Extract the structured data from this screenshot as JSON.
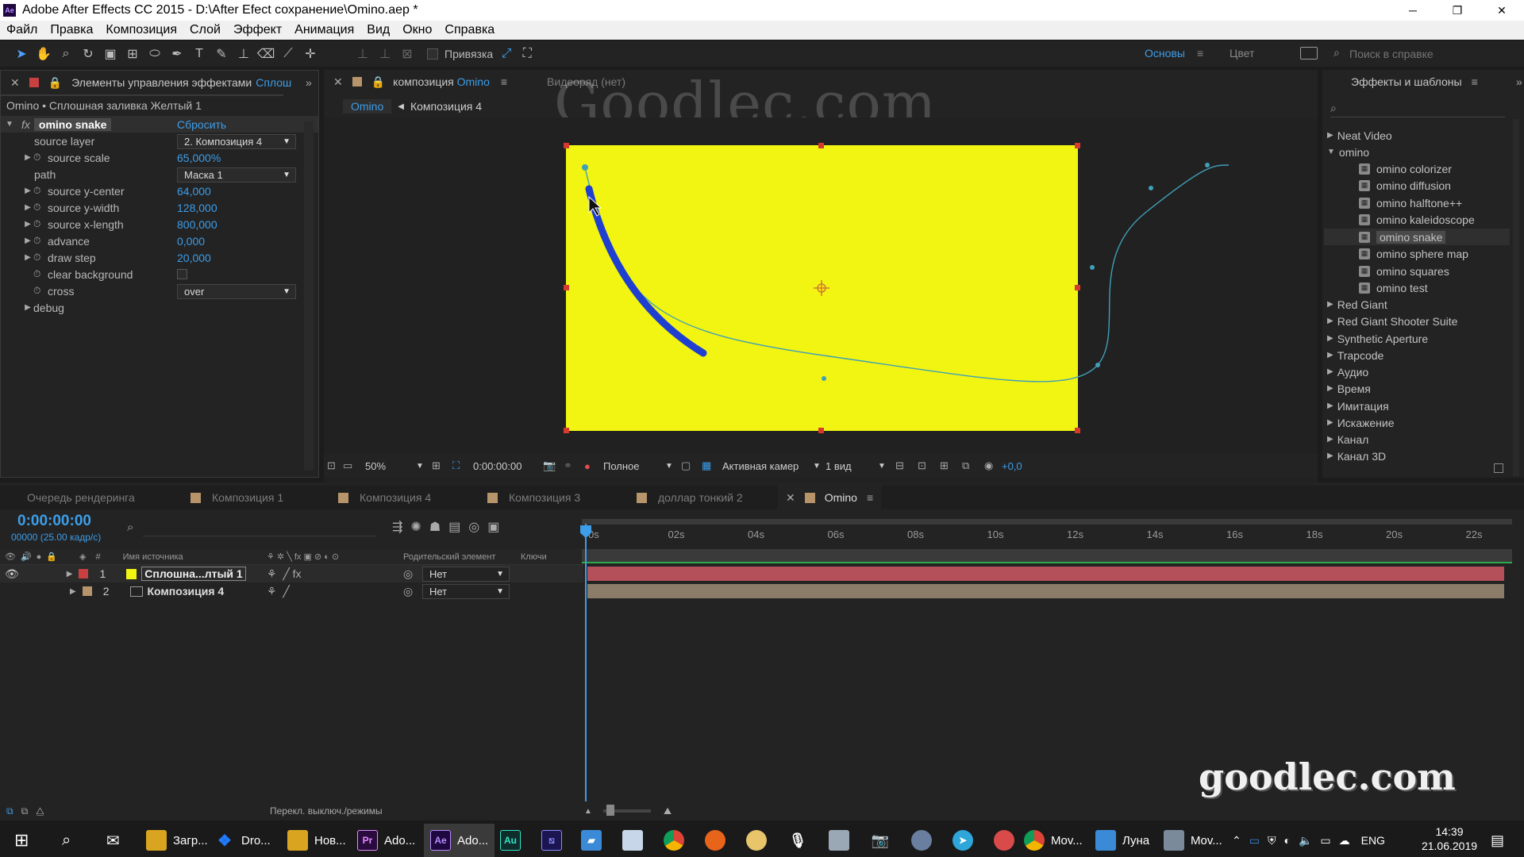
{
  "app": {
    "title": "Adobe After Effects CC 2015 - D:\\After Efect сохранение\\Omino.aep *",
    "logo": "Ae"
  },
  "menu": [
    "Файл",
    "Правка",
    "Композиция",
    "Слой",
    "Эффект",
    "Анимация",
    "Вид",
    "Окно",
    "Справка"
  ],
  "toolbar": {
    "snap_label": "Привязка",
    "workspace_basic": "Основы",
    "workspace_color": "Цвет",
    "help_search_placeholder": "Поиск в справке"
  },
  "effects_panel": {
    "tab_title": "Элементы управления эффектами",
    "tab_layer": "Сплош",
    "layer_path": "Omino • Сплошная заливка Желтый 1",
    "effect_name": "omino snake",
    "reset_label": "Сбросить",
    "params": [
      {
        "name": "source layer",
        "value": "2. Композиция 4",
        "kind": "dropdown"
      },
      {
        "name": "source scale",
        "value": "65,000%",
        "kind": "number"
      },
      {
        "name": "path",
        "value": "Маска 1",
        "kind": "dropdown"
      },
      {
        "name": "source y-center",
        "value": "64,000",
        "kind": "number"
      },
      {
        "name": "source y-width",
        "value": "128,000",
        "kind": "number"
      },
      {
        "name": "source x-length",
        "value": "800,000",
        "kind": "number"
      },
      {
        "name": "advance",
        "value": "0,000",
        "kind": "number"
      },
      {
        "name": "draw step",
        "value": "20,000",
        "kind": "number"
      },
      {
        "name": "clear background",
        "value": "",
        "kind": "checkbox"
      },
      {
        "name": "cross",
        "value": "over",
        "kind": "dropdown"
      },
      {
        "name": "debug",
        "value": "",
        "kind": "group"
      }
    ]
  },
  "comp_panel": {
    "tab_prefix": "композиция",
    "tab_name": "Omino",
    "footage_tab": "Видеоряд (нет)",
    "breadcrumb_active": "Omino",
    "breadcrumb_next": "Композиция 4",
    "watermark_top": "Goodlec.com",
    "zoom": "50%",
    "timecode": "0:00:00:00",
    "quality": "Полное",
    "camera": "Активная камер",
    "views": "1 вид",
    "exposure": "+0,0",
    "canvas_color": "#f2f511",
    "stroke_color": "#1f3fd0"
  },
  "effects_browser": {
    "tab_title": "Эффекты и шаблоны",
    "items": [
      {
        "label": "Neat Video",
        "kind": "category",
        "open": false
      },
      {
        "label": "omino",
        "kind": "category",
        "open": true
      },
      {
        "label": "omino colorizer",
        "kind": "effect"
      },
      {
        "label": "omino diffusion",
        "kind": "effect"
      },
      {
        "label": "omino halftone++",
        "kind": "effect"
      },
      {
        "label": "omino kaleidoscope",
        "kind": "effect"
      },
      {
        "label": "omino snake",
        "kind": "effect",
        "selected": true
      },
      {
        "label": "omino sphere map",
        "kind": "effect"
      },
      {
        "label": "omino squares",
        "kind": "effect"
      },
      {
        "label": "omino test",
        "kind": "effect"
      },
      {
        "label": "Red Giant",
        "kind": "category",
        "open": false
      },
      {
        "label": "Red Giant Shooter Suite",
        "kind": "category",
        "open": false
      },
      {
        "label": "Synthetic Aperture",
        "kind": "category",
        "open": false
      },
      {
        "label": "Trapcode",
        "kind": "category",
        "open": false
      },
      {
        "label": "Аудио",
        "kind": "category",
        "open": false
      },
      {
        "label": "Время",
        "kind": "category",
        "open": false
      },
      {
        "label": "Имитация",
        "kind": "category",
        "open": false
      },
      {
        "label": "Искажение",
        "kind": "category",
        "open": false
      },
      {
        "label": "Канал",
        "kind": "category",
        "open": false
      },
      {
        "label": "Канал 3D",
        "kind": "category",
        "open": false
      }
    ]
  },
  "timeline": {
    "tabs": [
      "Очередь рендеринга",
      "Композиция 1",
      "Композиция 4",
      "Композиция 3",
      "доллар тонкий 2",
      "Omino"
    ],
    "active_tab": "Omino",
    "timecode": "0:00:00:00",
    "frame_info": "00000 (25.00 кадр/с)",
    "ticks": [
      "0s",
      "02s",
      "04s",
      "06s",
      "08s",
      "10s",
      "12s",
      "14s",
      "16s",
      "18s",
      "20s",
      "22s"
    ],
    "col_source": "Имя источника",
    "col_parent": "Родительский элемент",
    "col_keys": "Ключи",
    "layers": [
      {
        "num": "1",
        "name": "Сплошна...лтый 1",
        "parent": "Нет",
        "label_color": "#c84040",
        "bar_color": "#b4505a"
      },
      {
        "num": "2",
        "name": "Композиция 4",
        "parent": "Нет",
        "label_color": "#b7946a",
        "bar_color": "#8b7c6a"
      }
    ],
    "footer_toggle": "Перекл. выключ./режимы",
    "watermark_bottom": "goodlec.com"
  },
  "taskbar": {
    "apps": [
      {
        "label": "Загр...",
        "icon": "folder-icon"
      },
      {
        "label": "Dro...",
        "icon": "dropbox-icon"
      },
      {
        "label": "Нов...",
        "icon": "folder-icon"
      },
      {
        "label": "Ado...",
        "icon": "premiere-icon"
      },
      {
        "label": "Ado...",
        "icon": "aftereffects-icon"
      },
      {
        "label": "Mov...",
        "icon": "chrome-icon"
      },
      {
        "label": "Луна",
        "icon": "monitor-icon"
      },
      {
        "label": "Mov...",
        "icon": "player-icon"
      }
    ],
    "lang": "ENG",
    "time": "14:39",
    "date": "21.06.2019"
  }
}
